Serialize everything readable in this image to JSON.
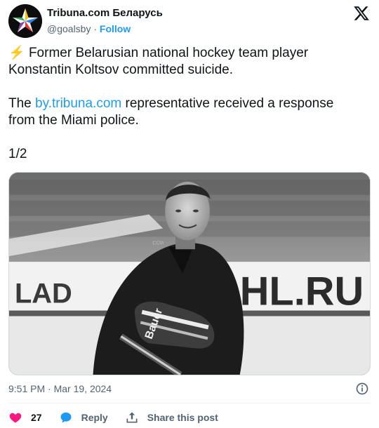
{
  "header": {
    "name": "Tribuna.com Беларусь",
    "handle": "@goalsby",
    "separator": "·",
    "follow": "Follow"
  },
  "tweet": {
    "emoji": "⚡",
    "line1": " Former Belarusian national hockey team player Konstantin Koltsov committed suicide.",
    "line2_prefix": "The ",
    "line2_link": "by.tribuna.com",
    "line2_suffix": " representative received a response from the Miami police.",
    "page_count": "1/2"
  },
  "photo": {
    "banner_left": "LAD",
    "banner_right": "HL.RU",
    "glove_brand": "Bauer",
    "jacket_brand": "CCM"
  },
  "meta": {
    "time": "9:51 PM",
    "date_separator": " · ",
    "date": "Mar 19, 2024"
  },
  "actions": {
    "likes": "27",
    "reply": "Reply",
    "share": "Share this post"
  },
  "colors": {
    "accent": "#1d9bf0",
    "like": "#f91880",
    "text": "#0f1419",
    "muted": "#536471"
  },
  "icons": [
    "avatar-star-logo",
    "x-logo-icon",
    "info-icon",
    "heart-icon",
    "reply-bubble-icon",
    "share-icon"
  ]
}
